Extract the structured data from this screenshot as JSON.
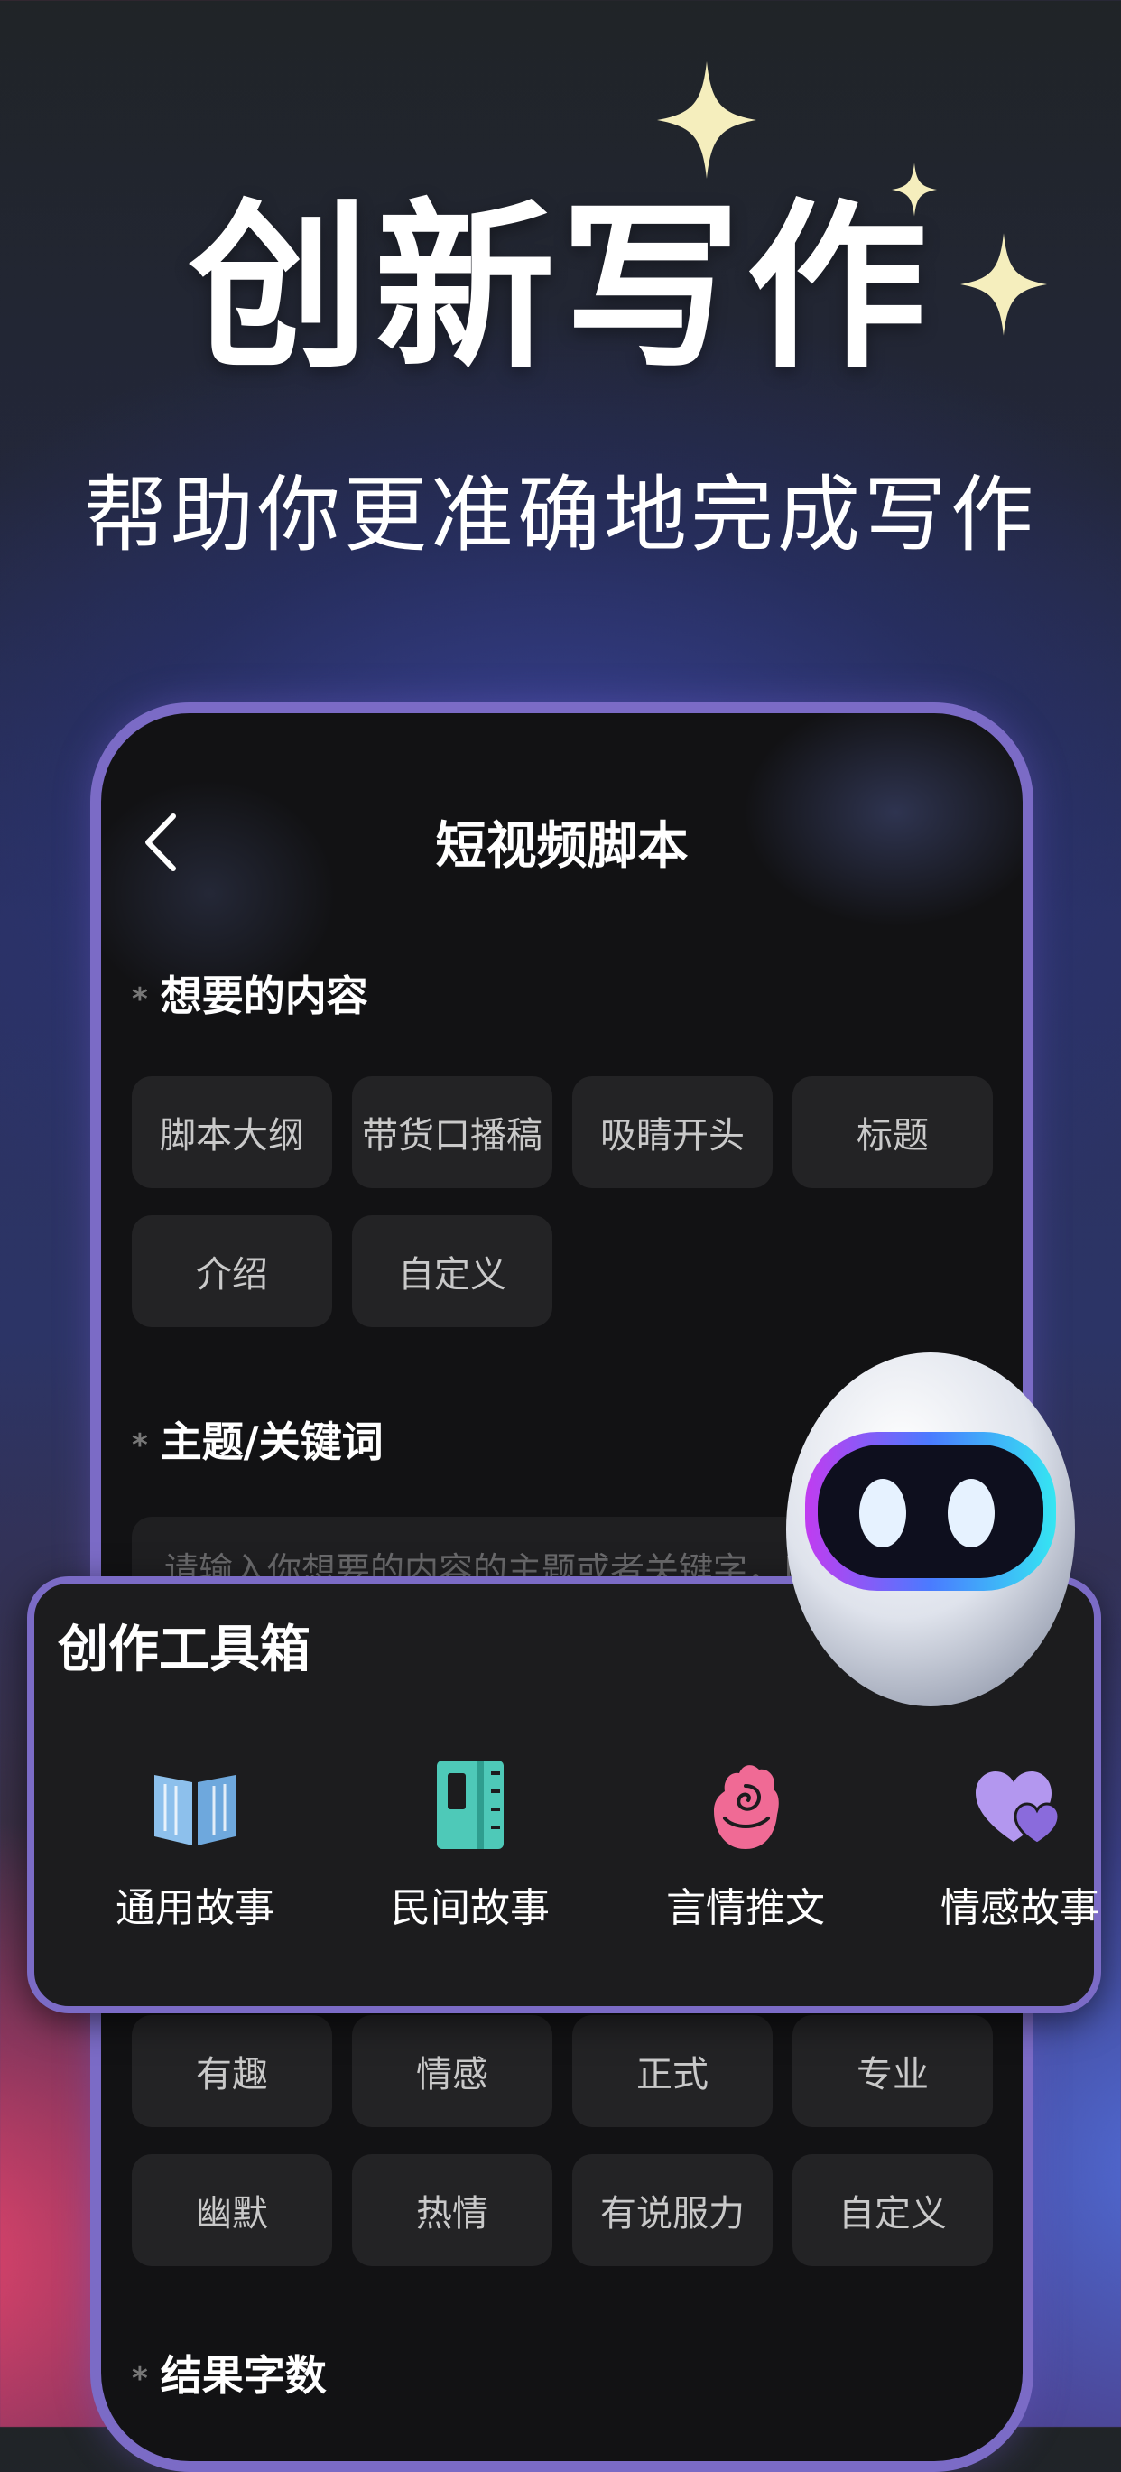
{
  "hero": {
    "title": "创新写作",
    "subtitle": "帮助你更准确地完成写作"
  },
  "phone": {
    "nav": {
      "title": "短视频脚本",
      "back_icon": "chevron-left-icon"
    },
    "content_section": {
      "label": "想要的内容",
      "required_mark": "*",
      "chips": [
        "脚本大纲",
        "带货口播稿",
        "吸睛开头",
        "标题",
        "介绍",
        "自定义"
      ]
    },
    "topic_section": {
      "label": "主题/关键词",
      "required_mark": "*",
      "placeholder": "请输入你想要的内容的主题或者关键字，以"
    },
    "tone_chips": [
      "有趣",
      "情感",
      "正式",
      "专业",
      "幽默",
      "热情",
      "有说服力",
      "自定义"
    ],
    "word_count_section": {
      "label": "结果字数",
      "required_mark": "*"
    }
  },
  "toolbox": {
    "title": "创作工具箱",
    "items": [
      {
        "label": "通用故事",
        "icon": "book-icon",
        "color": "#7fb4e6"
      },
      {
        "label": "民间故事",
        "icon": "notebook-icon",
        "color": "#4ec9b8"
      },
      {
        "label": "言情推文",
        "icon": "rose-icon",
        "color": "#f06a95"
      },
      {
        "label": "情感故事",
        "icon": "hearts-icon",
        "color": "#a58be6"
      }
    ]
  },
  "colors": {
    "accent": "#7b6bc6",
    "chip_bg": "#232325",
    "panel_bg": "#1c1c1e"
  }
}
